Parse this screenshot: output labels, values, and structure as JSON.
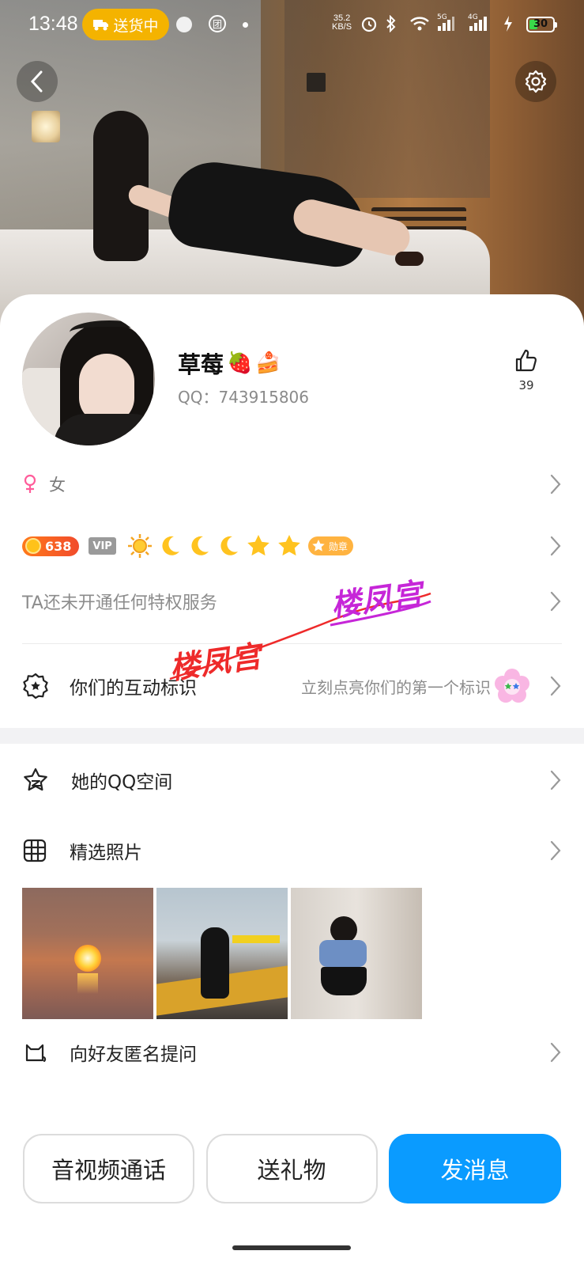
{
  "status_bar": {
    "time": "13:48",
    "delivery_pill": "送货中",
    "net_speed_value": "35.2",
    "net_speed_unit": "KB/S",
    "network_5g": "5G",
    "network_4g": "4G",
    "battery": "30",
    "battery_level": 0.3
  },
  "profile": {
    "nickname": "草莓",
    "nickname_emojis": [
      "🍓",
      "🍰"
    ],
    "qq_label": "QQ：743915806",
    "likes": "39",
    "gender": "女",
    "coin_level": "638",
    "vip_tag": "VIP",
    "medal_label": "勋章",
    "privilege_text": "TA还未开通任何特权服务",
    "interaction_label": "你们的互动标识",
    "interaction_hint": "立刻点亮你们的第一个标识"
  },
  "menu": {
    "qzone": "她的QQ空间",
    "photos": "精选照片",
    "anon_question": "向好友匿名提问"
  },
  "actions": {
    "call": "音视频通话",
    "gift": "送礼物",
    "message": "发消息"
  },
  "watermark": {
    "text_1": "楼凤宫",
    "text_2": "楼凤宫"
  },
  "colors": {
    "primary": "#0a9bff",
    "delivery": "#f4b300",
    "gender_icon": "#ff5c9a",
    "coin": "#f14b2c",
    "watermark_red": "#ee2a2a",
    "watermark_purple": "#c626d8"
  },
  "icons": {
    "back": "chevron-left-icon",
    "settings": "gear-icon",
    "like": "thumbs-up-icon",
    "gender": "female-icon",
    "interaction": "badge-star-icon",
    "qzone": "star-outline-icon",
    "photos": "grid-icon",
    "anon": "cat-icon"
  }
}
